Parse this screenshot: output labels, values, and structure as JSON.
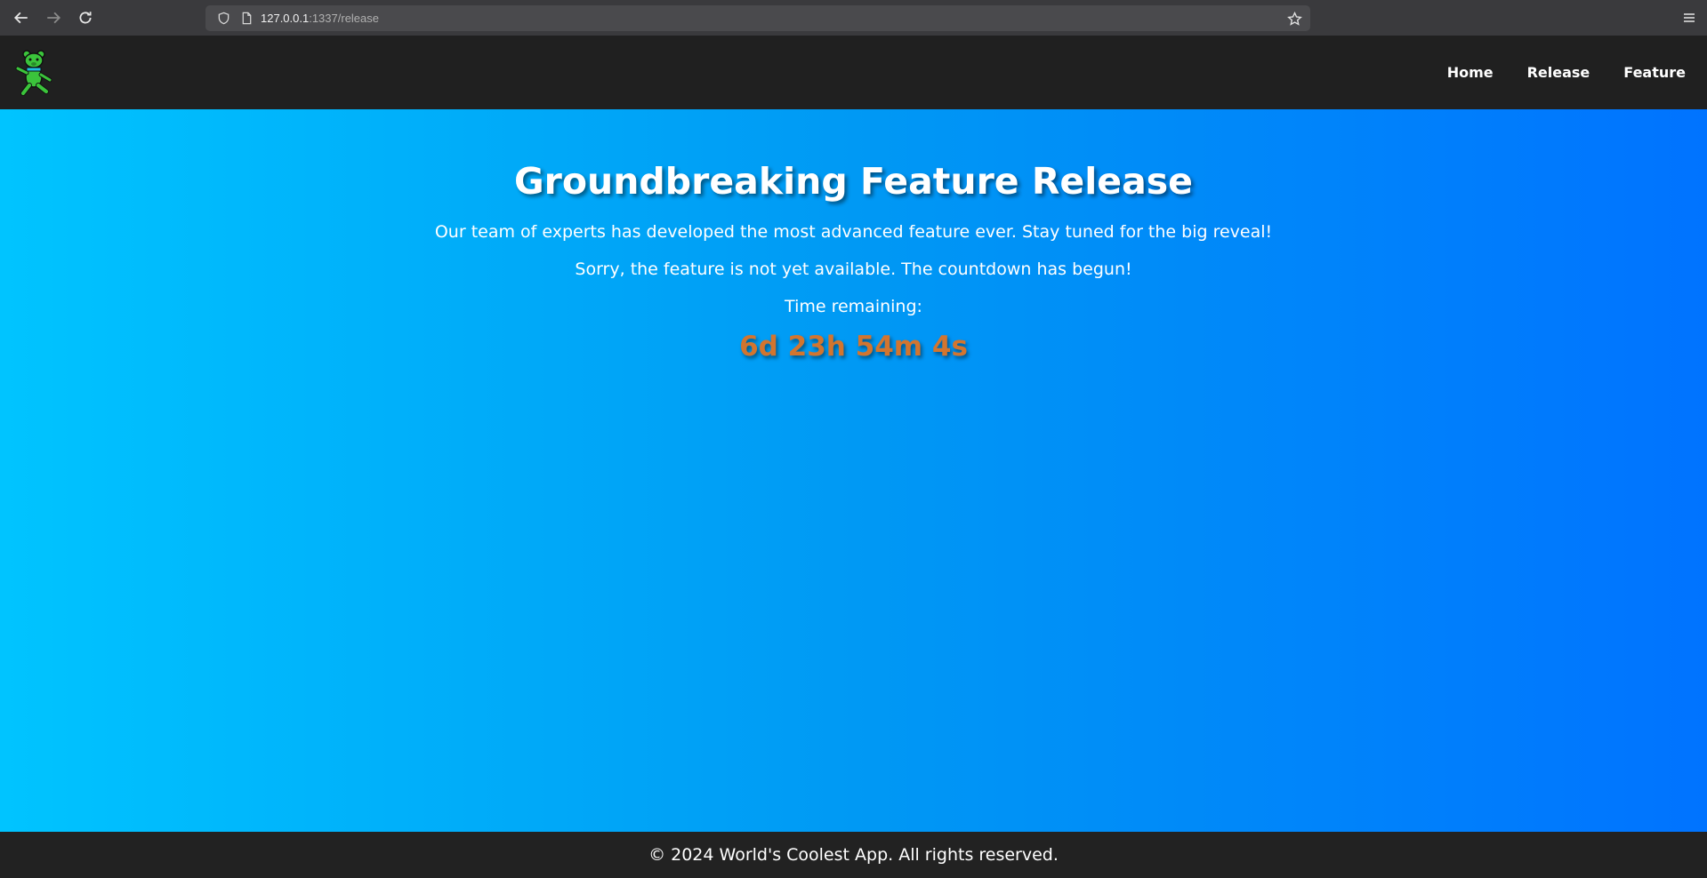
{
  "browser": {
    "url_host": "127.0.0.1",
    "url_path": ":1337/release"
  },
  "header": {
    "nav": [
      {
        "label": "Home"
      },
      {
        "label": "Release"
      },
      {
        "label": "Feature"
      }
    ]
  },
  "main": {
    "title": "Groundbreaking Feature Release",
    "description": "Our team of experts has developed the most advanced feature ever. Stay tuned for the big reveal!",
    "sorry": "Sorry, the feature is not yet available. The countdown has begun!",
    "time_label": "Time remaining:",
    "countdown": "6d 23h 54m 4s"
  },
  "footer": {
    "text": "© 2024 World's Coolest App. All rights reserved."
  },
  "colors": {
    "gradient_start": "#00c4ff",
    "gradient_end": "#0073ff",
    "countdown": "#d2752f",
    "header_bg": "#202020"
  }
}
